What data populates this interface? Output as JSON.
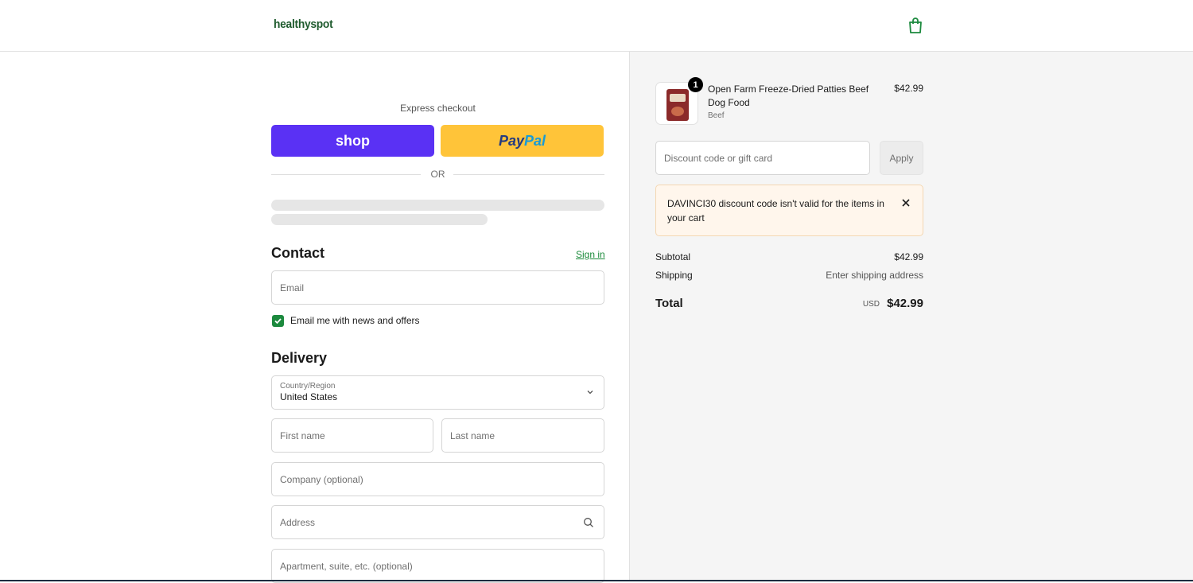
{
  "header": {
    "logo": "healthyspot",
    "cart_icon": "shopping-bag-icon"
  },
  "express": {
    "label": "Express checkout",
    "shop_label": "shop",
    "paypal_dark": "Pay",
    "paypal_light": "Pal",
    "or_label": "OR"
  },
  "contact": {
    "title": "Contact",
    "signin_label": "Sign in",
    "email_placeholder": "Email",
    "newsletter_label": "Email me with news and offers",
    "newsletter_checked": true
  },
  "delivery": {
    "title": "Delivery",
    "country_label": "Country/Region",
    "country_value": "United States",
    "first_name_placeholder": "First name",
    "last_name_placeholder": "Last name",
    "company_placeholder": "Company (optional)",
    "address_placeholder": "Address",
    "apartment_placeholder": "Apartment, suite, etc. (optional)"
  },
  "cart": {
    "item": {
      "quantity": "1",
      "name": "Open Farm Freeze-Dried Patties Beef Dog Food",
      "variant": "Beef",
      "price": "$42.99"
    },
    "discount_placeholder": "Discount code or gift card",
    "apply_label": "Apply",
    "alert": {
      "code": "DAVINCI30",
      "message": " discount code isn't valid for the items in your cart"
    },
    "subtotal_label": "Subtotal",
    "subtotal_value": "$42.99",
    "shipping_label": "Shipping",
    "shipping_value": "Enter shipping address",
    "total_label": "Total",
    "total_currency": "USD",
    "total_value": "$42.99"
  },
  "colors": {
    "shop_purple": "#5a31f4",
    "paypal_yellow": "#ffc439",
    "brand_green": "#1c8a3e",
    "alert_bg": "#fff6ec"
  }
}
